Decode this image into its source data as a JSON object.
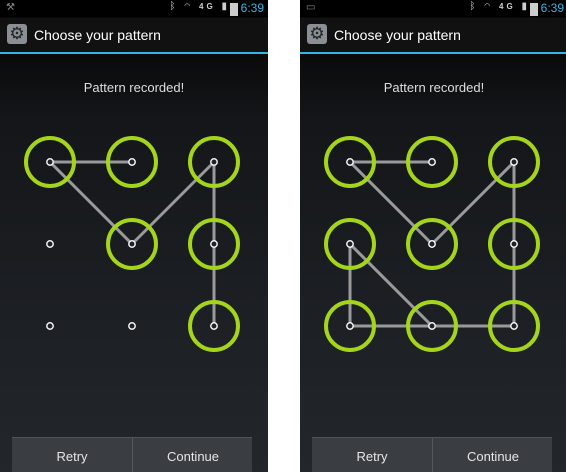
{
  "screens": [
    {
      "status": {
        "clock": "6:39",
        "network": "4G"
      },
      "action_bar": {
        "title": "Choose your pattern",
        "icon": "settings-gear-icon"
      },
      "header": "Pattern recorded!",
      "pattern": {
        "grid": [
          3,
          3
        ],
        "selected_dots": [
          1,
          2,
          3,
          5,
          6,
          9
        ],
        "path": [
          2,
          1,
          5,
          3,
          6,
          9
        ],
        "ring_color": "#a4d51b",
        "line_color": "#9a9a9a"
      },
      "buttons": {
        "retry": "Retry",
        "continue": "Continue"
      }
    },
    {
      "status": {
        "clock": "6:39",
        "network": "4G"
      },
      "action_bar": {
        "title": "Choose your pattern",
        "icon": "settings-gear-icon"
      },
      "header": "Pattern recorded!",
      "pattern": {
        "grid": [
          3,
          3
        ],
        "selected_dots": [
          1,
          2,
          3,
          4,
          5,
          6,
          7,
          8,
          9
        ],
        "path": [
          2,
          1,
          5,
          3,
          6,
          9,
          8,
          7,
          4,
          8
        ],
        "ring_color": "#a4d51b",
        "line_color": "#9a9a9a"
      },
      "buttons": {
        "retry": "Retry",
        "continue": "Continue"
      }
    }
  ]
}
